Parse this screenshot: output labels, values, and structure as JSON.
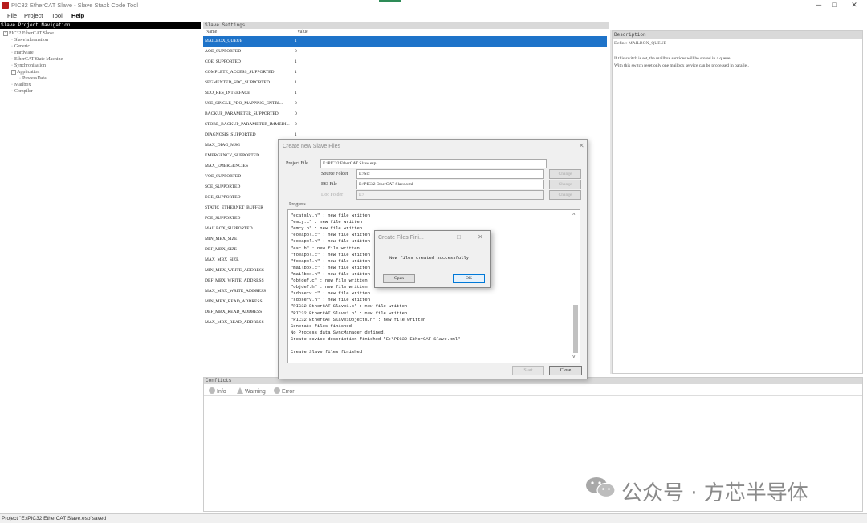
{
  "window": {
    "title": "PIC32 EtherCAT Slave - Slave Stack Code Tool"
  },
  "menu": [
    "File",
    "Project",
    "Tool",
    "Help"
  ],
  "nav": {
    "header": "Slave Project Navigation",
    "items": [
      {
        "label": "PIC32 EtherCAT Slave",
        "level": 0,
        "expander": "-"
      },
      {
        "label": "SlaveInformation",
        "level": 1
      },
      {
        "label": "Generic",
        "level": 1
      },
      {
        "label": "Hardware",
        "level": 1
      },
      {
        "label": "EtherCAT State Machine",
        "level": 1
      },
      {
        "label": "Synchronisation",
        "level": 1
      },
      {
        "label": "Application",
        "level": 1,
        "expander": "+"
      },
      {
        "label": "ProcessData",
        "level": 2
      },
      {
        "label": "Mailbox",
        "level": 1
      },
      {
        "label": "Compiler",
        "level": 1
      }
    ]
  },
  "settings": {
    "header": "Slave Settings",
    "col_name": "Name",
    "col_value": "Value",
    "rows": [
      {
        "name": "MAILBOX_QUEUE",
        "value": "1",
        "selected": true
      },
      {
        "name": "AOE_SUPPORTED",
        "value": "0"
      },
      {
        "name": "COE_SUPPORTED",
        "value": "1"
      },
      {
        "name": "COMPLETE_ACCESS_SUPPORTED",
        "value": "1"
      },
      {
        "name": "SEGMENTED_SDO_SUPPORTED",
        "value": "1"
      },
      {
        "name": "SDO_RES_INTERFACE",
        "value": "1"
      },
      {
        "name": "USE_SINGLE_PDO_MAPPING_ENTRI...",
        "value": "0"
      },
      {
        "name": "BACKUP_PARAMETER_SUPPORTED",
        "value": "0"
      },
      {
        "name": "STORE_BACKUP_PARAMETER_IMMEDI...",
        "value": "0"
      },
      {
        "name": "DIAGNOSIS_SUPPORTED",
        "value": "1"
      },
      {
        "name": "MAX_DIAG_MSG",
        "value": ""
      },
      {
        "name": "EMERGENCY_SUPPORTED",
        "value": ""
      },
      {
        "name": "MAX_EMERGENCIES",
        "value": ""
      },
      {
        "name": "VOE_SUPPORTED",
        "value": ""
      },
      {
        "name": "SOE_SUPPORTED",
        "value": ""
      },
      {
        "name": "EOE_SUPPORTED",
        "value": ""
      },
      {
        "name": "STATIC_ETHERNET_BUFFER",
        "value": ""
      },
      {
        "name": "FOE_SUPPORTED",
        "value": ""
      },
      {
        "name": "MAILBOX_SUPPORTED",
        "value": ""
      },
      {
        "name": "MIN_MBX_SIZE",
        "value": ""
      },
      {
        "name": "DEF_MBX_SIZE",
        "value": ""
      },
      {
        "name": "MAX_MBX_SIZE",
        "value": ""
      },
      {
        "name": "MIN_MBX_WRITE_ADDRESS",
        "value": ""
      },
      {
        "name": "DEF_MBX_WRITE_ADDRESS",
        "value": ""
      },
      {
        "name": "MAX_MBX_WRITE_ADDRESS",
        "value": ""
      },
      {
        "name": "MIN_MBX_READ_ADDRESS",
        "value": ""
      },
      {
        "name": "DEF_MBX_READ_ADDRESS",
        "value": ""
      },
      {
        "name": "MAX_MBX_READ_ADDRESS",
        "value": ""
      }
    ]
  },
  "description": {
    "header": "Description",
    "define": "Define: MAILBOX_QUEUE",
    "text_1": "If this switch is set, the mailbox services will be stored in a queue.",
    "text_2": "With this switch reset only one mailbox service can be processed in parallel."
  },
  "conflicts": {
    "header": "Conflicts",
    "info": "Info",
    "warning": "Warning",
    "error": "Error"
  },
  "status": "Project \"E:\\PIC32 EtherCAT Slave.esp\"saved",
  "create_dialog": {
    "title": "Create new Slave Files",
    "project_file_label": "Project File",
    "project_file": "E:\\PIC32 EtherCAT Slave.esp",
    "source_folder_label": "Source Folder",
    "source_folder": "E:\\Src",
    "esi_file_label": "ESI File",
    "esi_file": "E:\\PIC32 EtherCAT Slave.xml",
    "doc_folder_label": "Doc Folder",
    "doc_folder": "E:\\",
    "change": "Change",
    "progress_label": "Progress",
    "log": [
      "\"ecatslv.h\" : new file written",
      "\"emcy.c\" : new file written",
      "\"emcy.h\" : new file written",
      "\"eoeappl.c\" : new file written",
      "\"eoeappl.h\" : new file written",
      "\"esc.h\" : new file written",
      "\"foeappl.c\" : new file written",
      "\"foeappl.h\" : new file written",
      "\"mailbox.c\" : new file written",
      "\"mailbox.h\" : new file written",
      "\"objdef.c\" : new file written",
      "\"objdef.h\" : new file written",
      "\"sdoserv.c\" : new file written",
      "\"sdoserv.h\" : new file written",
      "\"PIC32 EtherCAT Slave1.c\" : new file written",
      "\"PIC32 EtherCAT Slave1.h\" : new file written",
      "\"PIC32 EtherCAT Slave1Objects.h\" : new file written",
      "Generate files finished",
      "No Process data SyncManager defined.",
      "Create device description finished \"E:\\PIC32 EtherCAT Slave.xml\"",
      "",
      "Create Slave files finished"
    ],
    "start": "Start",
    "close": "Close"
  },
  "finish_dialog": {
    "title": "Create Files Fini...",
    "message": "New files created successfully.",
    "open": "Open",
    "ok": "OK"
  },
  "watermark": {
    "text": "公众号 · 方芯半导体"
  }
}
